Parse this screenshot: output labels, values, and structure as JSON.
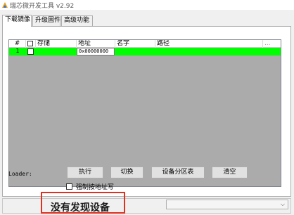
{
  "window": {
    "title": "瑞芯微开发工具 v2.92"
  },
  "tabs": [
    {
      "label": "下载镜像",
      "active": true
    },
    {
      "label": "升级固件",
      "active": false
    },
    {
      "label": "高级功能",
      "active": false
    }
  ],
  "grid": {
    "columns": [
      "#",
      "",
      "存储",
      "地址",
      "名字",
      "路径",
      "..."
    ],
    "rows": [
      {
        "index": "1",
        "storage": "",
        "address": "0x00000000",
        "name": "",
        "path": ""
      }
    ],
    "row_color": "#00ff00"
  },
  "loader_label": "Loader:",
  "buttons": {
    "execute": "执行",
    "switch": "切换",
    "partition_table": "设备分区表",
    "clear": "清空"
  },
  "force_address": {
    "label": "强制按地址写",
    "checked": false
  },
  "status": {
    "text": "没有发现设备",
    "highlight_color": "#e03020"
  },
  "device_select": {
    "value": ""
  }
}
